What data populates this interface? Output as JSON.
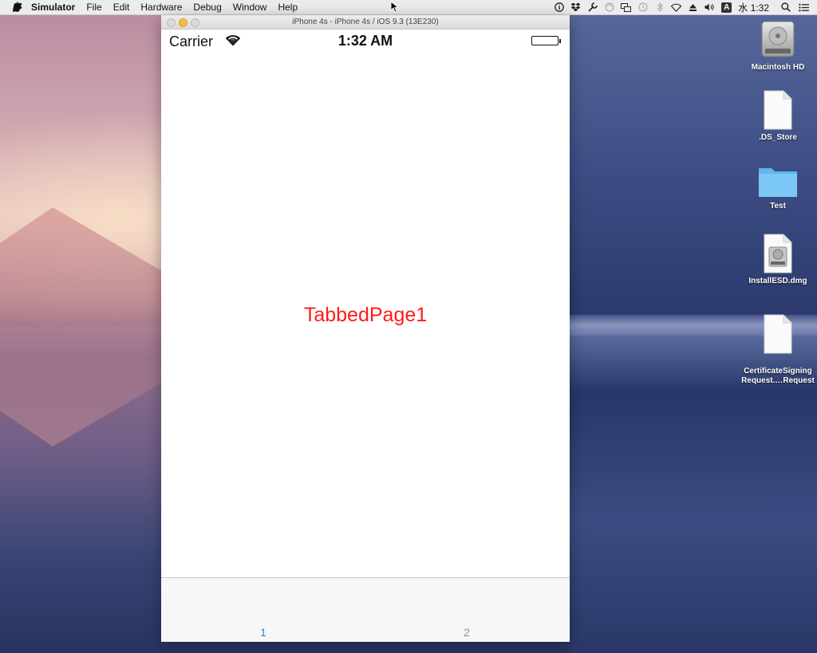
{
  "menubar": {
    "app_name": "Simulator",
    "items": [
      "File",
      "Edit",
      "Hardware",
      "Debug",
      "Window",
      "Help"
    ],
    "status_icons": [
      "info-icon",
      "dropbox-icon",
      "tools-icon",
      "sync-icon",
      "display-icon",
      "time-machine-icon",
      "bluetooth-icon",
      "wifi-icon",
      "eject-icon",
      "volume-icon"
    ],
    "input_source": "A",
    "clock": "水 1:32"
  },
  "simulator": {
    "window_title": "iPhone 4s - iPhone 4s / iOS 9.3 (13E230)",
    "status_bar": {
      "carrier": "Carrier",
      "time": "1:32 AM"
    },
    "page_label": "TabbedPage1",
    "page_label_color": "#ff1a1a",
    "tabs": [
      {
        "label": "1",
        "selected": true
      },
      {
        "label": "2",
        "selected": false
      }
    ],
    "tab_selected_color": "#1e88e5",
    "tab_unselected_color": "#929292"
  },
  "desktop": {
    "icons": [
      {
        "label": "Macintosh HD",
        "icon": "hard-drive-icon"
      },
      {
        "label": ".DS_Store",
        "icon": "document-icon"
      },
      {
        "label": "Test",
        "icon": "folder-icon"
      },
      {
        "label": "InstallESD.dmg",
        "icon": "disk-image-icon"
      },
      {
        "label": "CertificateSigning\nRequest.…Request",
        "icon": "document-icon"
      }
    ]
  }
}
